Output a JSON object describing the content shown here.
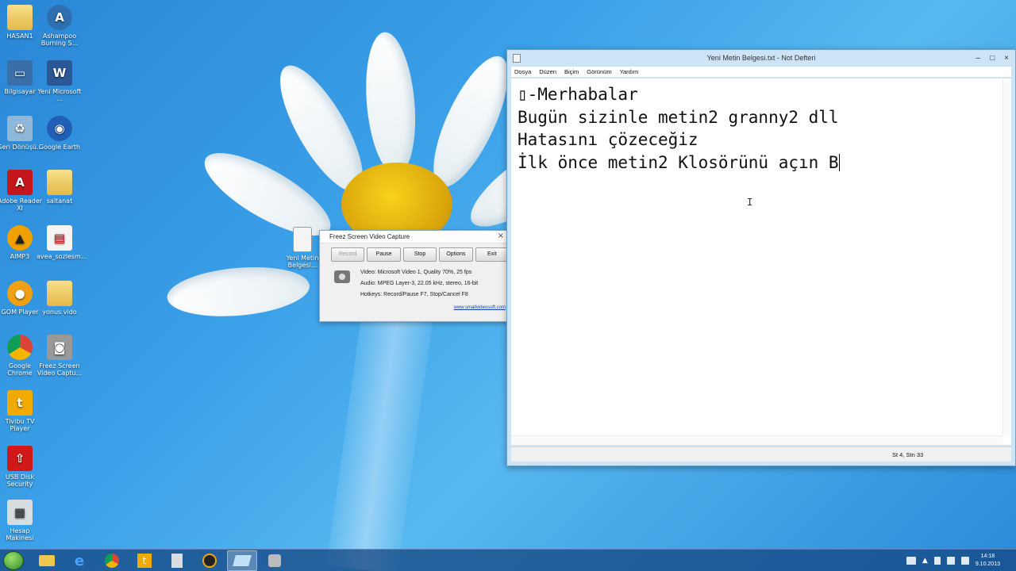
{
  "desktop": {
    "icons": [
      {
        "label": "HASAN1",
        "icon": "folder-icon"
      },
      {
        "label": "Ashampoo Burning S...",
        "icon": "ashampoo-icon"
      },
      {
        "label": "Bilgisayar",
        "icon": "computer-icon"
      },
      {
        "label": "Yeni Microsoft ...",
        "icon": "word-doc-icon"
      },
      {
        "label": "Geri Dönüşü...",
        "icon": "recycle-bin-icon"
      },
      {
        "label": "Google Earth",
        "icon": "google-earth-icon"
      },
      {
        "label": "Adobe Reader XI",
        "icon": "adobe-reader-icon"
      },
      {
        "label": "saltanat",
        "icon": "folder-icon"
      },
      {
        "label": "AIMP3",
        "icon": "aimp-icon"
      },
      {
        "label": "avea_sozlesm...",
        "icon": "pdf-icon"
      },
      {
        "label": "GOM Player",
        "icon": "gom-player-icon"
      },
      {
        "label": "yonus vido",
        "icon": "folder-icon"
      },
      {
        "label": "Google Chrome",
        "icon": "chrome-icon"
      },
      {
        "label": "Freez Screen Video Captu...",
        "icon": "camera-icon"
      },
      {
        "label": "Tivibu TV Player",
        "icon": "tivibu-icon"
      },
      {
        "label": "USB Disk Security",
        "icon": "usb-security-icon"
      },
      {
        "label": "Hesap Makinesi",
        "icon": "calculator-icon"
      }
    ],
    "floating_icon": "Yeni Metin Belgesi..."
  },
  "freez": {
    "title": "Freez Screen Video Capture",
    "close": "×",
    "buttons": {
      "record": "Record",
      "pause": "Pause",
      "stop": "Stop",
      "options": "Options",
      "exit": "Exit"
    },
    "video": "Video: Microsoft Video 1, Quality 70%, 25 fps",
    "audio": "Audio: MPEG Layer-3, 22.05 kHz, stereo, 16-bit",
    "hotkeys": "Hotkeys: Record/Pause F7, Stop/Cancel F8",
    "link": "www.smallvideosoft.com"
  },
  "notepad": {
    "title": "Yeni Metin Belgesi.txt - Not Defteri",
    "controls": {
      "minimize": "–",
      "maximize": "□",
      "close": "×"
    },
    "menu": {
      "file": "Dosya",
      "edit": "Düzen",
      "format": "Biçim",
      "view": "Görünüm",
      "help": "Yardım"
    },
    "lines": [
      "▯-Merhabalar",
      "Bugün sizinle metin2 granny2 dll",
      "Hatasını çözeceğiz",
      "İlk önce metin2 Klosörünü açın B"
    ],
    "status": "St 4, Stn 33"
  },
  "taskbar": {
    "apps": [
      "file-explorer-icon",
      "internet-explorer-icon",
      "chrome-icon",
      "tivibu-icon",
      "calculator-icon",
      "gom-player-icon",
      "notepad-icon",
      "camera-icon"
    ],
    "clock": {
      "time": "14:18",
      "date": "9.10.2013"
    }
  }
}
